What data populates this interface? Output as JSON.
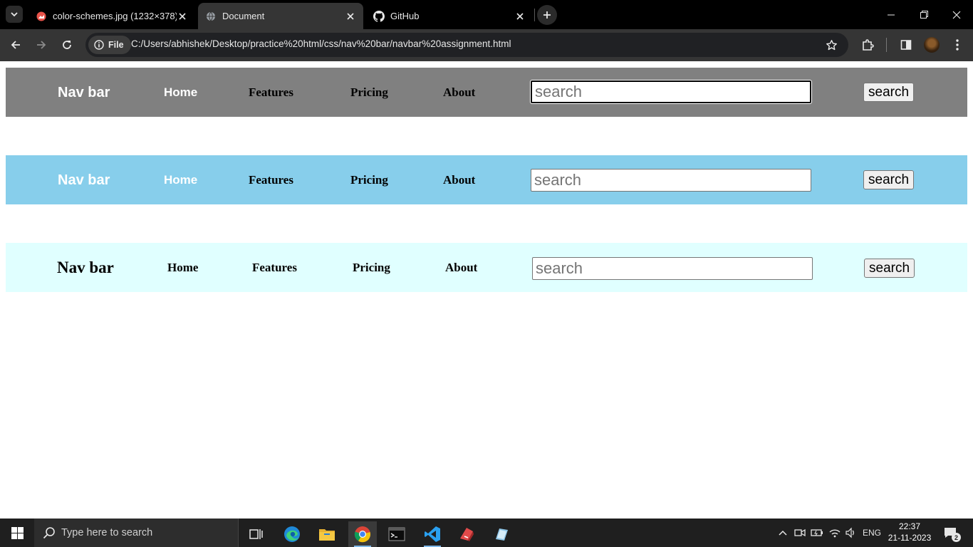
{
  "browser": {
    "tabs": [
      {
        "title": "color-schemes.jpg (1232×378)",
        "icon": "image-favicon-icon",
        "active": false
      },
      {
        "title": "Document",
        "icon": "globe-icon",
        "active": true
      },
      {
        "title": "GitHub",
        "icon": "github-icon",
        "active": false
      }
    ],
    "omnibox": {
      "chip_label": "File",
      "url": "C:/Users/abhishek/Desktop/practice%20html/css/nav%20bar/navbar%20assignment.html"
    }
  },
  "page": {
    "navbars": [
      {
        "brand": "Nav bar",
        "links": [
          "Home",
          "Features",
          "Pricing",
          "About"
        ],
        "search_placeholder": "search",
        "search_value": "",
        "button": "search",
        "background": "#808080",
        "brand_color": "#ffffff",
        "home_color": "#ffffff",
        "link_color": "#000000"
      },
      {
        "brand": "Nav bar",
        "links": [
          "Home",
          "Features",
          "Pricing",
          "About"
        ],
        "search_placeholder": "search",
        "search_value": "",
        "button": "search",
        "background": "#87ceeb",
        "brand_color": "#ffffff",
        "home_color": "#ffffff",
        "link_color": "#000000"
      },
      {
        "brand": "Nav bar",
        "links": [
          "Home",
          "Features",
          "Pricing",
          "About"
        ],
        "search_placeholder": "search",
        "search_value": "",
        "button": "search",
        "background": "#e0ffff",
        "brand_color": "#000000",
        "home_color": "#000000",
        "link_color": "#000000"
      }
    ]
  },
  "taskbar": {
    "search_placeholder": "Type here to search",
    "language": "ENG",
    "time": "22:37",
    "date": "21-11-2023",
    "notification_count": "2",
    "apps": [
      "task-view-icon",
      "edge-icon",
      "file-explorer-icon",
      "chrome-icon",
      "terminal-icon",
      "vscode-icon",
      "app-red-icon",
      "app-blue-icon"
    ]
  }
}
